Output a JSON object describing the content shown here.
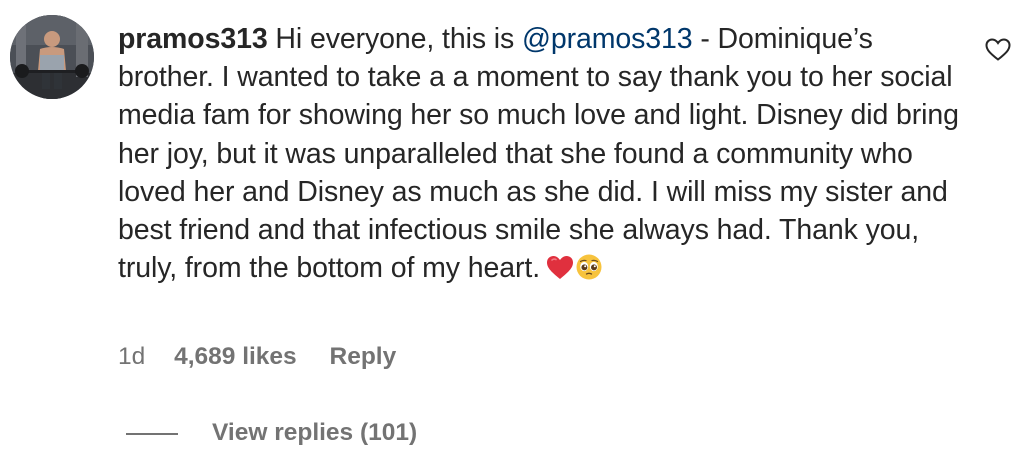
{
  "comment": {
    "username": "pramos313",
    "text_before_mention": " Hi everyone, this is ",
    "mention": "@pramos313",
    "text_after_mention": " - Dominique’s brother. I wanted to take a a moment to say thank you to her social media fam for showing her so much love and light. Disney did bring her joy, but it was unparalleled that she found a community who loved her and Disney as much as she did. I will miss my sister and best friend and that infectious smile she always had. Thank you, truly, from the bottom of my heart.",
    "emojis": [
      "red-heart",
      "pleading-face"
    ],
    "age": "1d",
    "likes": "4,689 likes",
    "reply_label": "Reply",
    "view_replies_label": "View replies (101)",
    "like_icon": "heart-outline-icon"
  },
  "colors": {
    "text": "#262626",
    "mention": "#00376b",
    "secondary": "#737373"
  }
}
